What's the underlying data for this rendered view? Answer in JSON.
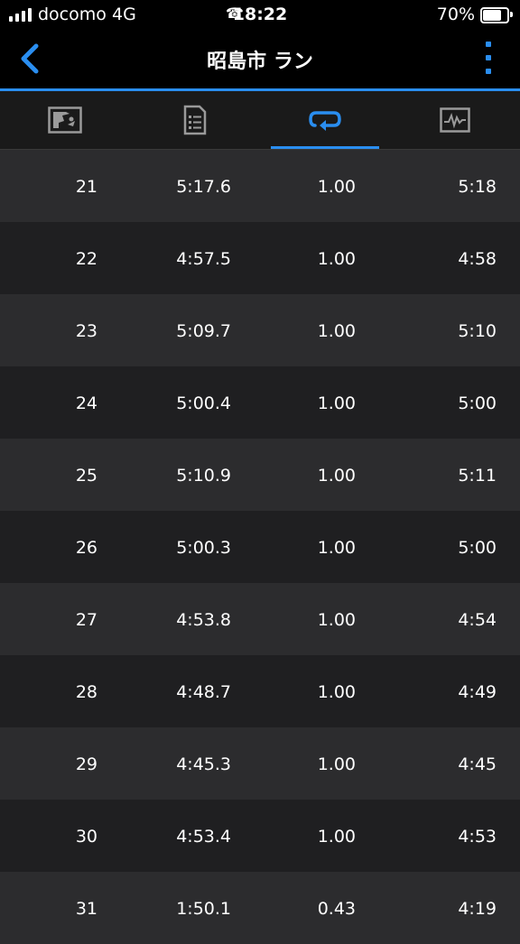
{
  "status_bar": {
    "carrier": "docomo",
    "network": "4G",
    "time": "18:22",
    "battery": "70%"
  },
  "header": {
    "title": "昭島市 ラン"
  },
  "tabs": [
    {
      "icon": "map-icon",
      "active": false
    },
    {
      "icon": "summary-document-icon",
      "active": false
    },
    {
      "icon": "laps-loop-icon",
      "active": true
    },
    {
      "icon": "chart-graph-icon",
      "active": false
    }
  ],
  "colors": {
    "accent": "#2a8ef0",
    "row_light": "#2c2c2e",
    "row_dark": "#1f1f21"
  },
  "laps": [
    [
      "21",
      "5:17.6",
      "1.00",
      "5:18"
    ],
    [
      "22",
      "4:57.5",
      "1.00",
      "4:58"
    ],
    [
      "23",
      "5:09.7",
      "1.00",
      "5:10"
    ],
    [
      "24",
      "5:00.4",
      "1.00",
      "5:00"
    ],
    [
      "25",
      "5:10.9",
      "1.00",
      "5:11"
    ],
    [
      "26",
      "5:00.3",
      "1.00",
      "5:00"
    ],
    [
      "27",
      "4:53.8",
      "1.00",
      "4:54"
    ],
    [
      "28",
      "4:48.7",
      "1.00",
      "4:49"
    ],
    [
      "29",
      "4:45.3",
      "1.00",
      "4:45"
    ],
    [
      "30",
      "4:53.4",
      "1.00",
      "4:53"
    ],
    [
      "31",
      "1:50.1",
      "0.43",
      "4:19"
    ]
  ]
}
